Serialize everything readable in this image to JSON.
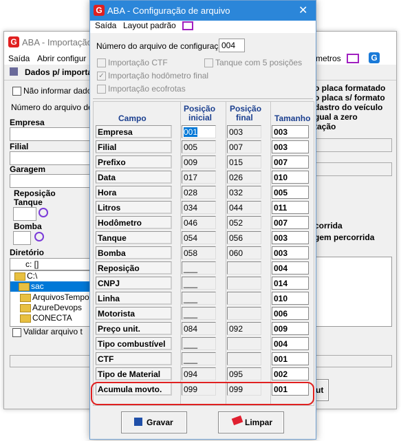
{
  "background_window": {
    "title": "ABA - Importação",
    "menu": {
      "saida": "Saída",
      "abrir": "Abrir configur",
      "parametros": "metros"
    },
    "toolbar": {
      "dados": "Dados p/ importa"
    },
    "nao_informar": "Não informar dados",
    "numero_arquivo": "Número do arquivo de c",
    "empresa": "Empresa",
    "filial": "Filial",
    "garagem": "Garagem",
    "reposicao": "Reposição",
    "tanque": "Tanque",
    "bomba": "Bomba",
    "diretorio": "Diretório",
    "drive": "c: []",
    "folders": [
      "C:\\",
      "sac",
      "ArquivosTempo",
      "AzureDevops",
      "CONECTA"
    ],
    "validar": "Validar arquivo t",
    "right_options": [
      "o placa formatado",
      "o placa s/ formato",
      "dastro do veículo",
      "gual a zero",
      "tação"
    ],
    "right_opts2": [
      "corrida",
      "gem percorrida"
    ],
    "ok_button": "ut"
  },
  "dialog": {
    "title": "ABA - Configuração de arquivo",
    "menu": {
      "saida": "Saída",
      "layout": "Layout padrão"
    },
    "numero_label": "Número do arquivo de configuração :",
    "numero_value": "004",
    "options": {
      "ctf": "Importação CTF",
      "tanque5": "Tanque com 5 posições",
      "hodometro": "Importação hodômetro final",
      "ecofrotas": "Importação ecofrotas"
    },
    "headers": {
      "campo": "Campo",
      "pos_ini_1": "Posição",
      "pos_ini_2": "inicial",
      "pos_fin_1": "Posição",
      "pos_fin_2": "final",
      "tamanho": "Tamanho"
    },
    "rows": [
      {
        "campo": "Empresa",
        "ini": "001",
        "fim": "003",
        "tam": "003"
      },
      {
        "campo": "Filial",
        "ini": "005",
        "fim": "007",
        "tam": "003"
      },
      {
        "campo": "Prefixo",
        "ini": "009",
        "fim": "015",
        "tam": "007"
      },
      {
        "campo": "Data",
        "ini": "017",
        "fim": "026",
        "tam": "010"
      },
      {
        "campo": "Hora",
        "ini": "028",
        "fim": "032",
        "tam": "005"
      },
      {
        "campo": "Litros",
        "ini": "034",
        "fim": "044",
        "tam": "011"
      },
      {
        "campo": "Hodômetro",
        "ini": "046",
        "fim": "052",
        "tam": "007"
      },
      {
        "campo": "Tanque",
        "ini": "054",
        "fim": "056",
        "tam": "003"
      },
      {
        "campo": "Bomba",
        "ini": "058",
        "fim": "060",
        "tam": "003"
      },
      {
        "campo": "Reposição",
        "ini": "___",
        "fim": "",
        "tam": "004"
      },
      {
        "campo": "CNPJ",
        "ini": "___",
        "fim": "",
        "tam": "014"
      },
      {
        "campo": "Linha",
        "ini": "___",
        "fim": "",
        "tam": "010"
      },
      {
        "campo": "Motorista",
        "ini": "___",
        "fim": "",
        "tam": "006"
      },
      {
        "campo": "Preço unit.",
        "ini": "084",
        "fim": "092",
        "tam": "009"
      },
      {
        "campo": "Tipo combustível",
        "ini": "___",
        "fim": "",
        "tam": "004"
      },
      {
        "campo": "CTF",
        "ini": "___",
        "fim": "",
        "tam": "001"
      },
      {
        "campo": "Tipo de Material",
        "ini": "094",
        "fim": "095",
        "tam": "002"
      },
      {
        "campo": "Acumula movto.",
        "ini": "099",
        "fim": "099",
        "tam": "001"
      }
    ],
    "buttons": {
      "gravar": "Gravar",
      "limpar": "Limpar"
    },
    "highlight_color": "#e02020"
  }
}
